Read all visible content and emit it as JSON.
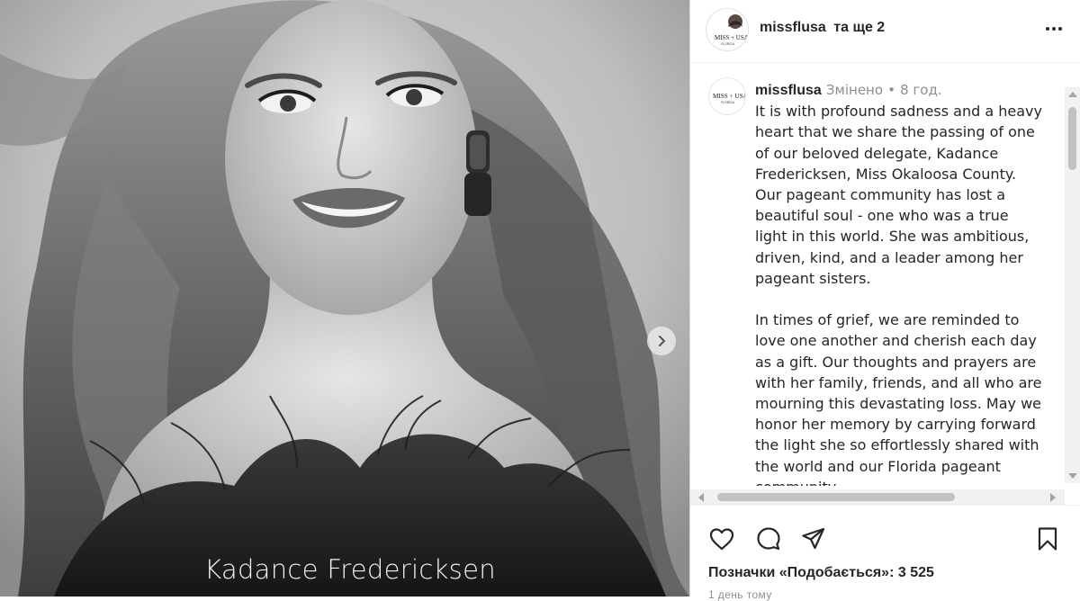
{
  "media": {
    "caption": "Kadance Fredericksen",
    "next_icon": "chevron-right-icon"
  },
  "header": {
    "username": "missflusa",
    "extra": "та ще 2",
    "more_icon": "more-horizontal-icon"
  },
  "avatar": {
    "logo_text": "MISS + USA",
    "logo_subtext": "FLORIDA"
  },
  "comment": {
    "username": "missflusa",
    "edited": "Змінено",
    "separator": "•",
    "time": "8 год.",
    "lines": [
      "It is with profound sadness and a heavy",
      "heart that we share the passing of one",
      "of our beloved delegate, Kadance",
      "Fredericksen, Miss Okaloosa County.",
      "Our pageant community has lost a",
      "beautiful soul - one who was a true",
      "light in this world. She was ambitious,",
      "driven, kind, and a leader among her",
      "pageant sisters.",
      "",
      "In times of grief, we are reminded to",
      "love one another and cherish each day",
      "as a gift. Our thoughts and prayers are",
      "with her family, friends, and all who are",
      "mourning this devastating loss. May we",
      "honor her memory by carrying forward",
      "the light she so effortlessly shared with",
      "the world and our Florida pageant",
      "community."
    ]
  },
  "actions": {
    "icons": [
      "heart-icon",
      "comment-icon",
      "share-icon",
      "bookmark-icon"
    ],
    "likes_text": "Позначки «Подобається»: 3 525",
    "date_text": "1 день тому"
  }
}
